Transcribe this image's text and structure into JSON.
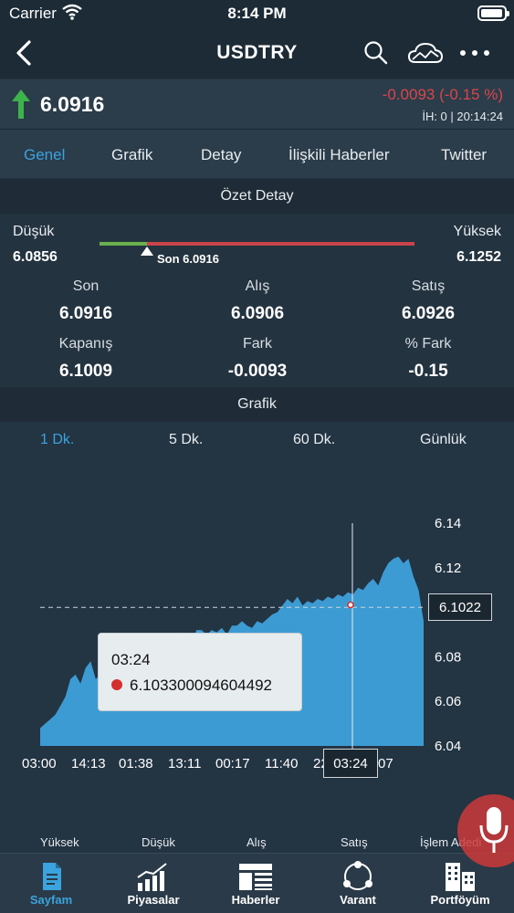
{
  "status_bar": {
    "carrier": "Carrier",
    "time": "8:14 PM"
  },
  "nav": {
    "title": "USDTRY"
  },
  "quote": {
    "price": "6.0916",
    "change": "-0.0093 (-0.15 %)",
    "info": "İH:  0 | 20:14:24",
    "up_color": "#3cb44b",
    "down_color": "#d9464a"
  },
  "tabs": [
    "Genel",
    "Grafik",
    "Detay",
    "İlişkili Haberler",
    "Twitter"
  ],
  "summary": {
    "header": "Özet Detay",
    "low_label": "Düşük",
    "low_value": "6.0856",
    "high_label": "Yüksek",
    "high_value": "6.1252",
    "last_marker": "Son 6.0916",
    "last_position": 0.15,
    "stats": [
      {
        "label": "Son",
        "value": "6.0916"
      },
      {
        "label": "Alış",
        "value": "6.0906"
      },
      {
        "label": "Satış",
        "value": "6.0926"
      },
      {
        "label": "Kapanış",
        "value": "6.1009"
      },
      {
        "label": "Fark",
        "value": "-0.0093"
      },
      {
        "label": "% Fark",
        "value": "-0.15"
      }
    ]
  },
  "chart_section": {
    "header": "Grafik",
    "periods": [
      "1 Dk.",
      "5 Dk.",
      "60 Dk.",
      "Günlük"
    ],
    "active_period": "1 Dk.",
    "tooltip_time": "03:24",
    "tooltip_value": "6.103300094604492",
    "current_label": "6.1022",
    "crosshair_label": "03:24"
  },
  "chart_data": {
    "type": "area",
    "x_ticks": [
      "03:00",
      "14:13",
      "01:38",
      "13:11",
      "00:17",
      "11:40",
      "22",
      "07"
    ],
    "y_ticks": [
      "6.14",
      "6.12",
      "6.10",
      "6.08",
      "6.06",
      "6.04"
    ],
    "ylim": [
      6.04,
      6.14
    ],
    "reference_line": 6.1022,
    "crosshair": {
      "x": "03:24",
      "y": 6.1033
    },
    "values": [
      6.048,
      6.05,
      6.052,
      6.054,
      6.058,
      6.062,
      6.07,
      6.072,
      6.068,
      6.075,
      6.078,
      6.07,
      6.072,
      6.065,
      6.078,
      6.08,
      6.076,
      6.072,
      6.078,
      6.082,
      6.08,
      6.085,
      6.082,
      6.088,
      6.086,
      6.083,
      6.09,
      6.088,
      6.091,
      6.09,
      6.086,
      6.092,
      6.092,
      6.09,
      6.092,
      6.091,
      6.093,
      6.09,
      6.094,
      6.094,
      6.096,
      6.094,
      6.093,
      6.096,
      6.095,
      6.097,
      6.099,
      6.1,
      6.103,
      6.106,
      6.104,
      6.107,
      6.103,
      6.105,
      6.104,
      6.106,
      6.105,
      6.107,
      6.106,
      6.108,
      6.107,
      6.109,
      6.108,
      6.111,
      6.11,
      6.113,
      6.115,
      6.112,
      6.118,
      6.122,
      6.124,
      6.125,
      6.122,
      6.124,
      6.116,
      6.11,
      6.096
    ],
    "color": "#3d9bd3"
  },
  "bottom_stats": [
    "Yüksek",
    "Düşük",
    "Alış",
    "Satış",
    "İşlem Adedi"
  ],
  "tab_bar": [
    {
      "label": "Sayfam",
      "icon": "document-icon"
    },
    {
      "label": "Piyasalar",
      "icon": "bar-chart-icon"
    },
    {
      "label": "Haberler",
      "icon": "news-icon"
    },
    {
      "label": "Varant",
      "icon": "network-icon"
    },
    {
      "label": "Portföyüm",
      "icon": "buildings-icon"
    }
  ]
}
